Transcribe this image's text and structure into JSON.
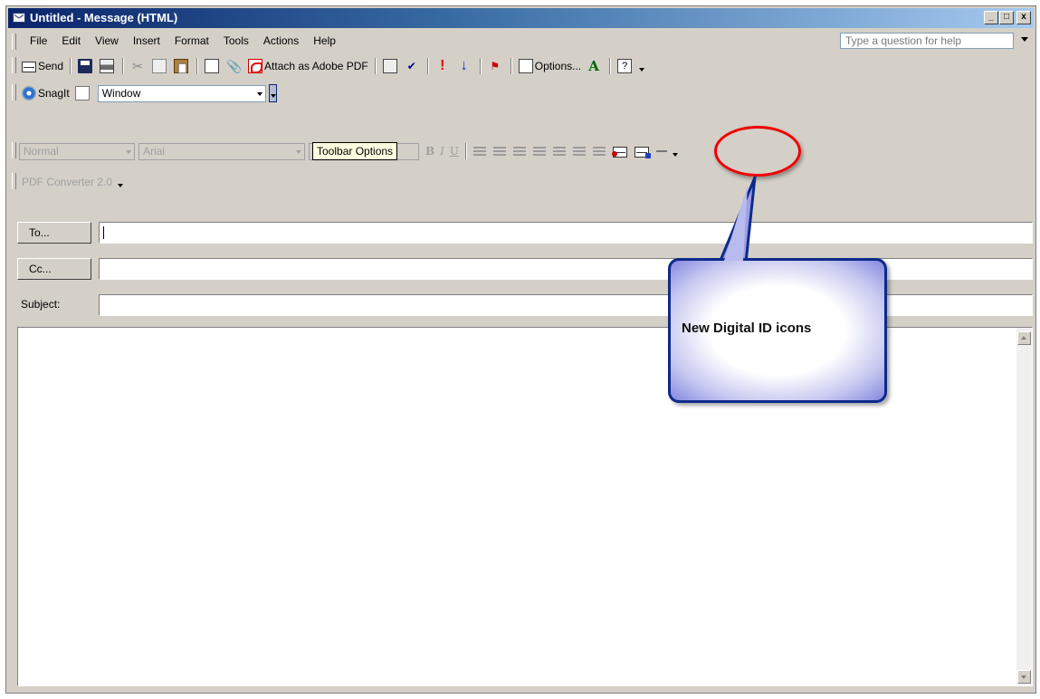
{
  "window": {
    "title": "Untitled - Message (HTML)",
    "min_label": "_",
    "max_label": "□",
    "close_label": "x"
  },
  "menu": {
    "items": [
      "File",
      "Edit",
      "View",
      "Insert",
      "Format",
      "Tools",
      "Actions",
      "Help"
    ],
    "help_placeholder": "Type a question for help"
  },
  "toolbar1": {
    "send_label": "Send",
    "attach_pdf_label": "Attach as Adobe PDF",
    "options_label": "Options..."
  },
  "toolbar2": {
    "snagit_label": "SnagIt",
    "capture_value": "Window"
  },
  "format_toolbar": {
    "style_value": "Normal",
    "font_value": "Arial",
    "tooltip": "Toolbar Options",
    "bold": "B",
    "italic": "I",
    "underline": "U"
  },
  "pdf_toolbar": {
    "label": "PDF Converter 2.0"
  },
  "fields": {
    "to_label": "To...",
    "cc_label": "Cc...",
    "subject_label": "Subject:",
    "to_value": "",
    "cc_value": "",
    "subject_value": ""
  },
  "callout": {
    "text": "New Digital ID icons",
    "ellipse_color": "#e00000",
    "box_border_color": "#0d2a8a"
  },
  "colors": {
    "titlebar_start": "#0a246a",
    "titlebar_end": "#a6caf0",
    "chrome": "#d4d0c8"
  }
}
